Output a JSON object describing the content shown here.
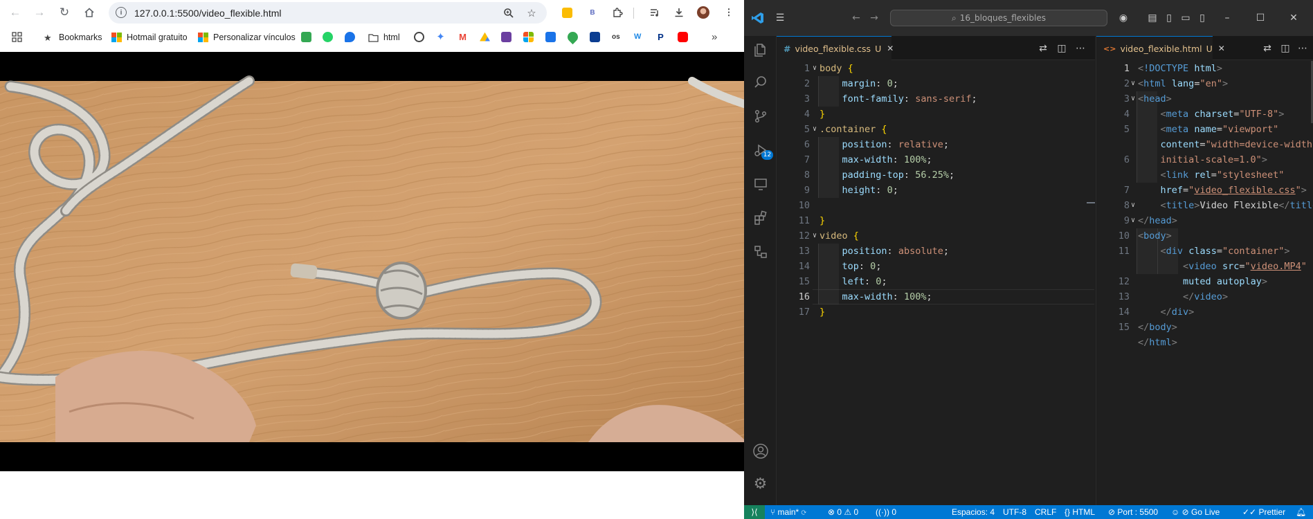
{
  "browser": {
    "url": "127.0.0.1:5500/video_flexible.html",
    "bookmarks_label": "Bookmarks",
    "hotmail_label": "Hotmail gratuito",
    "personalizar_label": "Personalizar vínculos",
    "html_folder_label": "html",
    "ext_b_label": "B",
    "video_description_icon": "rope-knot-video-frame"
  },
  "vscode": {
    "search_label": "16_bloques_flexibles",
    "scm_badge": "12",
    "css_tab": {
      "icon": "#",
      "name": "video_flexible.css",
      "status": "U"
    },
    "html_tab": {
      "icon": "<>",
      "name": "video_flexible.html",
      "status": "U"
    },
    "css_lines": [
      "1",
      "2",
      "3",
      "4",
      "5",
      "6",
      "7",
      "8",
      "9",
      "10",
      "11",
      "12",
      "13",
      "14",
      "15",
      "16",
      "17"
    ],
    "html_lines": [
      "1",
      "2",
      "3",
      "4",
      "5",
      "",
      "6",
      "",
      "7",
      "8",
      "9",
      "10",
      "11",
      "",
      "12",
      "13",
      "14",
      "15"
    ],
    "status": {
      "branch": "main*",
      "errors": "0",
      "warnings": "0",
      "ports": "0",
      "spaces": "Espacios: 4",
      "encoding": "UTF-8",
      "eol": "CRLF",
      "language": "HTML",
      "port": "Port : 5500",
      "golive": "Go Live",
      "prettier": "Prettier"
    }
  },
  "colors": {
    "accent": "#0078d4",
    "status_remote": "#16825d",
    "modified": "#e2c08d"
  }
}
